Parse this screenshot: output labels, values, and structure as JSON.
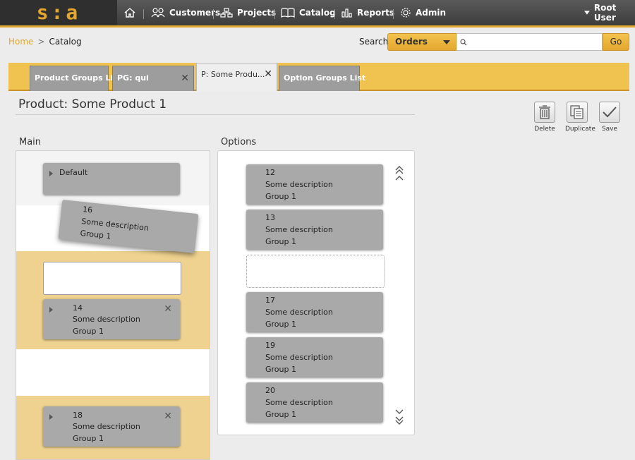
{
  "logo": "s:a",
  "nav": {
    "items": [
      {
        "label": "Customers",
        "icon": "users-icon"
      },
      {
        "label": "Projects",
        "icon": "sitemap-icon"
      },
      {
        "label": "Catalog",
        "icon": "book-icon"
      },
      {
        "label": "Reports",
        "icon": "bar-chart-icon"
      },
      {
        "label": "Admin",
        "icon": "gear-icon"
      }
    ],
    "user": "Root User"
  },
  "breadcrumb": {
    "home": "Home",
    "separator": ">",
    "current": "Catalog"
  },
  "search": {
    "label": "Search",
    "scope": "Orders",
    "value": "",
    "button": "Go"
  },
  "tabs": [
    {
      "label": "Product Groups List",
      "closable": false
    },
    {
      "label": "PG: qui",
      "closable": true
    },
    {
      "label": "P: Some Produ...",
      "closable": true,
      "active": true
    },
    {
      "label": "Option Groups List",
      "closable": false
    }
  ],
  "page_title": "Product: Some Product 1",
  "toolbar": {
    "delete": "Delete",
    "duplicate": "Duplicate",
    "save": "Save"
  },
  "main": {
    "label": "Main",
    "default_card": "Default",
    "dragging_card": {
      "id": "16",
      "description": "Some description",
      "group": "Group 1"
    },
    "cards": [
      {
        "id": "14",
        "description": "Some description",
        "group": "Group 1"
      },
      {
        "id": "18",
        "description": "Some description",
        "group": "Group 1"
      }
    ]
  },
  "options": {
    "label": "Options",
    "cards": [
      {
        "id": "12",
        "description": "Some description",
        "group": "Group 1"
      },
      {
        "id": "13",
        "description": "Some description",
        "group": "Group 1"
      },
      {
        "id": "17",
        "description": "Some description",
        "group": "Group 1"
      },
      {
        "id": "19",
        "description": "Some description",
        "group": "Group 1"
      },
      {
        "id": "20",
        "description": "Some description",
        "group": "Group 1"
      }
    ]
  },
  "colors": {
    "accent": "#e3a72f",
    "tab_strip": "#f0c24f",
    "drop_zone": "#efd28f",
    "card": "#a9a9a9"
  }
}
